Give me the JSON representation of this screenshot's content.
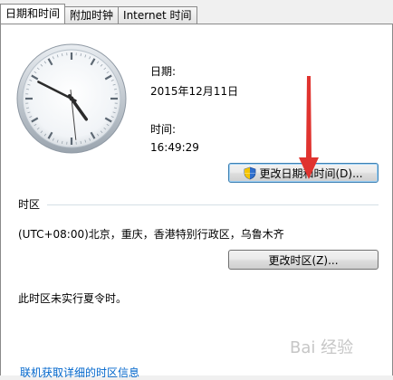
{
  "tabs": [
    {
      "label": "日期和时间",
      "active": true
    },
    {
      "label": "附加时钟",
      "active": false
    },
    {
      "label": "Internet 时间",
      "active": false
    }
  ],
  "date": {
    "label": "日期:",
    "value": "2015年12月11日"
  },
  "time": {
    "label": "时间:",
    "value": "16:49:29"
  },
  "buttons": {
    "change_datetime": "更改日期和时间(D)...",
    "change_timezone": "更改时区(Z)..."
  },
  "timezone": {
    "section_label": "时区",
    "value": "(UTC+08:00)北京，重庆，香港特别行政区，乌鲁木齐",
    "dst_note": "此时区未实行夏令时。"
  },
  "link": "联机获取详细的时区信息",
  "clock": {
    "hour": 16,
    "minute": 49,
    "second": 29
  },
  "colors": {
    "arrow": "#e0332f",
    "link": "#0066cc",
    "shield_blue": "#2f6fce",
    "shield_yellow": "#f5c400"
  },
  "icons": [
    "shield-icon",
    "clock-icon",
    "red-arrow-annotation"
  ],
  "watermark": "Bai 经验"
}
